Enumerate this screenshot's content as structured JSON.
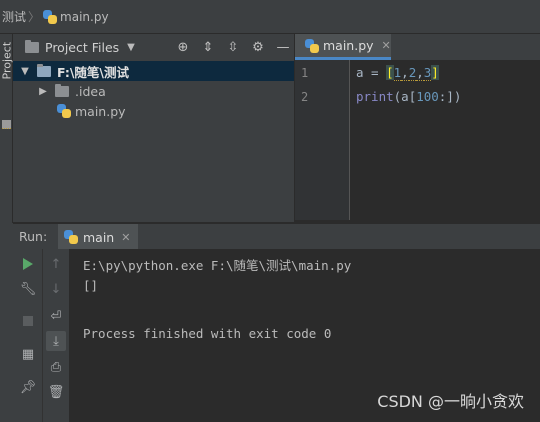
{
  "breadcrumb": {
    "folder": "测试",
    "file": "main.py"
  },
  "stripe": {
    "label": "Project"
  },
  "project": {
    "title": "Project Files",
    "tree": [
      {
        "label": "F:\\随笔\\测试",
        "kind": "folder",
        "expanded": true,
        "selected": true
      },
      {
        "label": ".idea",
        "kind": "folder",
        "expanded": false,
        "selected": false
      },
      {
        "label": "main.py",
        "kind": "python-file",
        "selected": false
      }
    ]
  },
  "editor": {
    "tab": "main.py",
    "lines": [
      {
        "number": "1",
        "code": "a = [1,2,3]"
      },
      {
        "number": "2",
        "code": "print(a[100:])"
      }
    ]
  },
  "run": {
    "label": "Run:",
    "tab": "main",
    "output": [
      "E:\\py\\python.exe F:\\随笔\\测试\\main.py",
      "[]",
      "",
      "Process finished with exit code 0"
    ]
  },
  "watermark": "CSDN @一晌小贪欢",
  "colors": {
    "selection": "#0d293e",
    "accent_tab": "#4a88c7",
    "run_green": "#59a869",
    "number": "#6897bb",
    "builtin": "#8888c6"
  }
}
